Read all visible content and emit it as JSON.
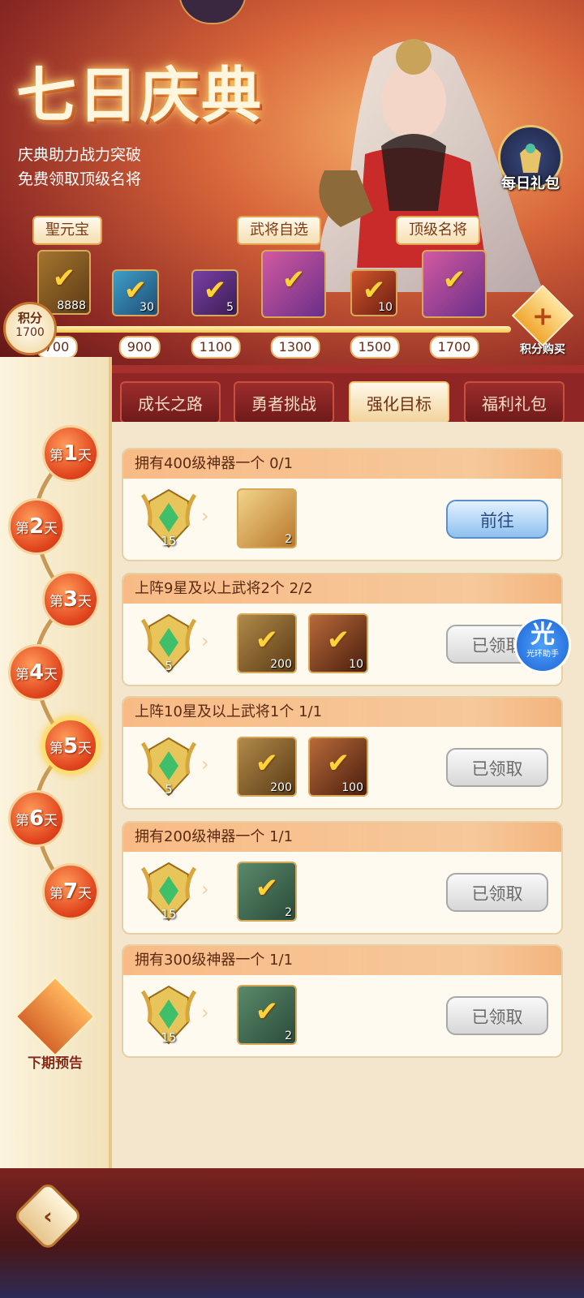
{
  "header": {
    "title": "七日庆典",
    "subtitle_lines": [
      "庆典助力战力突破",
      "免费领取顶级名将"
    ],
    "daily_gift_label": "每日礼包"
  },
  "milestones": {
    "tags": [
      "聖元宝",
      "武将自选",
      "顶级名将"
    ],
    "rewards": [
      {
        "count": "8888",
        "claimed": true
      },
      {
        "count": "30",
        "claimed": true
      },
      {
        "count": "5",
        "claimed": true
      },
      {
        "count": "",
        "claimed": true
      },
      {
        "count": "10",
        "claimed": true
      },
      {
        "count": "",
        "claimed": true
      }
    ],
    "points": [
      "700",
      "900",
      "1100",
      "1300",
      "1500",
      "1700"
    ],
    "progress_fraction": 1.0,
    "score_label": "积分",
    "score_value": "1700",
    "buy_label": "积分购买"
  },
  "tabs": [
    {
      "label": "成长之路",
      "active": false
    },
    {
      "label": "勇者挑战",
      "active": false
    },
    {
      "label": "强化目标",
      "active": true
    },
    {
      "label": "福利礼包",
      "active": false
    }
  ],
  "days": [
    {
      "prefix": "第",
      "num": "1",
      "suffix": "天"
    },
    {
      "prefix": "第",
      "num": "2",
      "suffix": "天"
    },
    {
      "prefix": "第",
      "num": "3",
      "suffix": "天"
    },
    {
      "prefix": "第",
      "num": "4",
      "suffix": "天"
    },
    {
      "prefix": "第",
      "num": "5",
      "suffix": "天"
    },
    {
      "prefix": "第",
      "num": "6",
      "suffix": "天"
    },
    {
      "prefix": "第",
      "num": "7",
      "suffix": "天"
    }
  ],
  "selected_day": "5",
  "preview_label": "下期预告",
  "tasks": [
    {
      "title": "拥有400级神器一个 0/1",
      "medal": "15",
      "items": [
        {
          "count": "2",
          "claimed": false
        }
      ],
      "button": "前往",
      "state": "go"
    },
    {
      "title": "上阵9星及以上武将2个 2/2",
      "medal": "5",
      "items": [
        {
          "count": "200",
          "claimed": true
        },
        {
          "count": "10",
          "claimed": true
        }
      ],
      "button": "已领取",
      "state": "done"
    },
    {
      "title": "上阵10星及以上武将1个 1/1",
      "medal": "5",
      "items": [
        {
          "count": "200",
          "claimed": true
        },
        {
          "count": "100",
          "claimed": true
        }
      ],
      "button": "已领取",
      "state": "done"
    },
    {
      "title": "拥有200级神器一个 1/1",
      "medal": "15",
      "items": [
        {
          "count": "2",
          "claimed": true
        }
      ],
      "button": "已领取",
      "state": "done"
    },
    {
      "title": "拥有300级神器一个 1/1",
      "medal": "15",
      "items": [
        {
          "count": "2",
          "claimed": true
        }
      ],
      "button": "已领取",
      "state": "done"
    }
  ],
  "assistant": {
    "glyph": "光",
    "label": "光环助手"
  },
  "colors": {
    "accent": "#e2461f",
    "panel": "#f3e6cd",
    "go_button": "#8ec0ee"
  }
}
